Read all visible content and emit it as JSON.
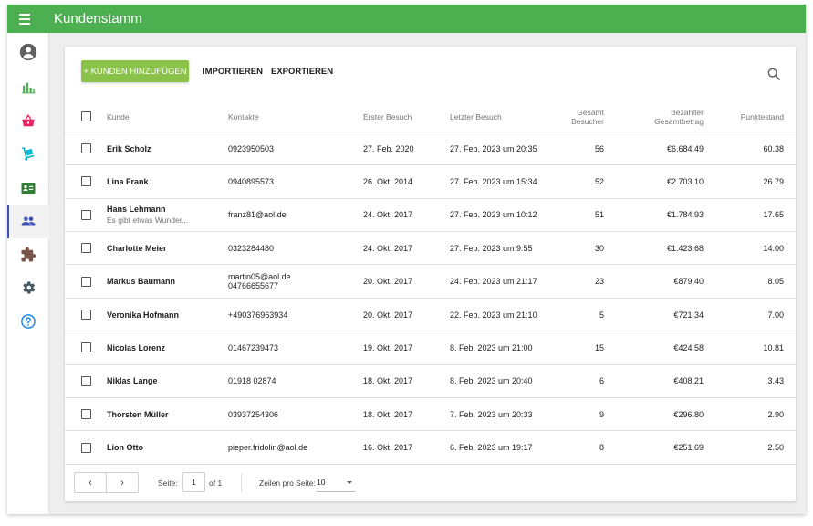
{
  "app": {
    "title": "Kundenstamm"
  },
  "sidebar": {
    "items": [
      {
        "name": "account-icon",
        "active": false
      },
      {
        "name": "bar-chart-icon",
        "active": false
      },
      {
        "name": "shopping-basket-icon",
        "active": false
      },
      {
        "name": "dolly-icon",
        "active": false
      },
      {
        "name": "contact-card-icon",
        "active": false
      },
      {
        "name": "people-icon",
        "active": true
      },
      {
        "name": "puzzle-icon",
        "active": false
      },
      {
        "name": "settings-icon",
        "active": false
      },
      {
        "name": "help-icon",
        "active": false
      }
    ],
    "colors": {
      "account": "#616161",
      "chart": "#4caf50",
      "basket": "#e91e63",
      "dolly": "#00bcd4",
      "card": "#2e7d32",
      "people": "#3f51b5",
      "puzzle": "#795548",
      "settings": "#455a64",
      "help": "#1e88e5"
    }
  },
  "toolbar": {
    "add_label": "+ KUNDEN HINZUFÜGEN",
    "import_label": "IMPORTIEREN",
    "export_label": "EXPORTIEREN",
    "search_icon": "search-icon"
  },
  "table": {
    "headers": {
      "name": "Kunde",
      "contact": "Kontakte",
      "first_visit": "Erster Besuch",
      "last_visit": "Letzter Besuch",
      "visits_line1": "Gesamt",
      "visits_line2": "Besucher",
      "paid_line1": "Bezahlter",
      "paid_line2": "Gesamtbetrag",
      "points": "Punktestand"
    },
    "rows": [
      {
        "name": "Erik Scholz",
        "note": "",
        "contact1": "0923950503",
        "contact2": "",
        "first_visit": "27. Feb. 2020",
        "last_visit": "27. Feb. 2023 um 20:35",
        "visits": "56",
        "paid": "€6.684,49",
        "points": "60.38"
      },
      {
        "name": "Lina Frank",
        "note": "",
        "contact1": "0940895573",
        "contact2": "",
        "first_visit": "26. Okt. 2014",
        "last_visit": "27. Feb. 2023 um 15:34",
        "visits": "52",
        "paid": "€2.703,10",
        "points": "26.79"
      },
      {
        "name": "Hans Lehmann",
        "note": "Es gibt etwas Wunder...",
        "contact1": "franz81@aol.de",
        "contact2": "",
        "first_visit": "24. Okt. 2017",
        "last_visit": "27. Feb. 2023 um 10:12",
        "visits": "51",
        "paid": "€1.784,93",
        "points": "17.65"
      },
      {
        "name": "Charlotte Meier",
        "note": "",
        "contact1": "0323284480",
        "contact2": "",
        "first_visit": "24. Okt. 2017",
        "last_visit": "27. Feb. 2023 um 9:55",
        "visits": "30",
        "paid": "€1.423,68",
        "points": "14.00"
      },
      {
        "name": "Markus Baumann",
        "note": "",
        "contact1": "martin05@aol.de",
        "contact2": "04766655677",
        "first_visit": "20. Okt. 2017",
        "last_visit": "24. Feb. 2023 um 21:17",
        "visits": "23",
        "paid": "€879,40",
        "points": "8.05"
      },
      {
        "name": "Veronika Hofmann",
        "note": "",
        "contact1": "+490376963934",
        "contact2": "",
        "first_visit": "20. Okt. 2017",
        "last_visit": "22. Feb. 2023 um 21:10",
        "visits": "5",
        "paid": "€721,34",
        "points": "7.00"
      },
      {
        "name": "Nicolas Lorenz",
        "note": "",
        "contact1": "01467239473",
        "contact2": "",
        "first_visit": "19. Okt. 2017",
        "last_visit": "8. Feb. 2023 um 21:00",
        "visits": "15",
        "paid": "€424.58",
        "points": "10.81"
      },
      {
        "name": "Niklas Lange",
        "note": "",
        "contact1": "01918 02874",
        "contact2": "",
        "first_visit": "18. Okt. 2017",
        "last_visit": "8. Feb. 2023 um 20:40",
        "visits": "6",
        "paid": "€408,21",
        "points": "3.43"
      },
      {
        "name": "Thorsten Müller",
        "note": "",
        "contact1": "03937254306",
        "contact2": "",
        "first_visit": "18. Okt. 2017",
        "last_visit": "7. Feb. 2023 um 20:33",
        "visits": "9",
        "paid": "€296,80",
        "points": "2.90"
      },
      {
        "name": "Lion Otto",
        "note": "",
        "contact1": "pieper.fridolin@aol.de",
        "contact2": "",
        "first_visit": "16. Okt. 2017",
        "last_visit": "6. Feb. 2023 um 19:17",
        "visits": "8",
        "paid": "€251,69",
        "points": "2.50"
      }
    ]
  },
  "footer": {
    "prev": "‹",
    "next": "›",
    "page_label": "Seite:",
    "page_value": "1",
    "of_label": "of 1",
    "rows_label": "Zeilen pro Seite:",
    "rows_value": "10"
  },
  "colors": {
    "appbar": "#4caf50",
    "add_button": "#8bc34a",
    "active_nav": "#3f51b5"
  }
}
